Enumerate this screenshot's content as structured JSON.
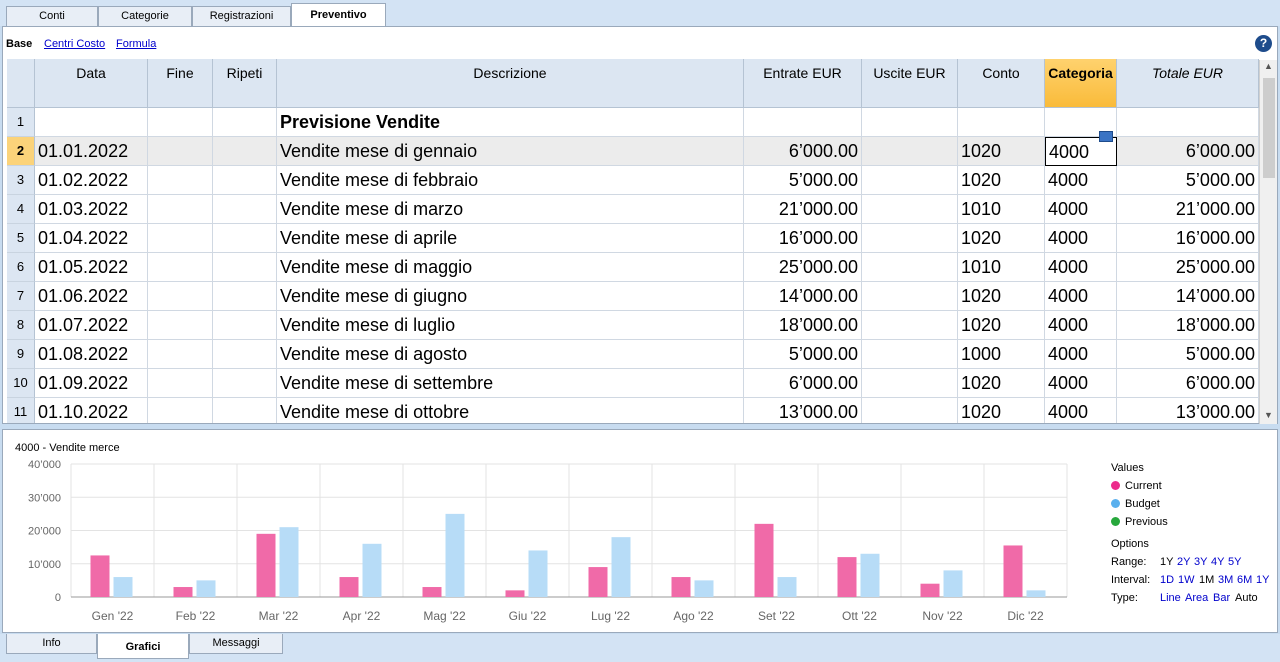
{
  "tabs": [
    "Conti",
    "Categorie",
    "Registrazioni",
    "Preventivo"
  ],
  "active_tab": "Preventivo",
  "views": {
    "base": "Base",
    "centri": "Centri Costo",
    "formula": "Formula"
  },
  "help_icon": "question-circle-icon",
  "columns": {
    "data": "Data",
    "fine": "Fine",
    "ripeti": "Ripeti",
    "descrizione": "Descrizione",
    "entrate": "Entrate EUR",
    "uscite": "Uscite EUR",
    "conto": "Conto",
    "categoria": "Categoria",
    "totale": "Totale EUR"
  },
  "rows": [
    {
      "n": "1",
      "data": "",
      "descrizione": "Previsione Vendite",
      "entrate": "",
      "conto": "",
      "categoria": "",
      "totale": ""
    },
    {
      "n": "2",
      "data": "01.01.2022",
      "descrizione": "Vendite mese di gennaio",
      "entrate": "6’000.00",
      "conto": "1020",
      "categoria": "4000",
      "totale": "6’000.00"
    },
    {
      "n": "3",
      "data": "01.02.2022",
      "descrizione": "Vendite mese di febbraio",
      "entrate": "5’000.00",
      "conto": "1020",
      "categoria": "4000",
      "totale": "5’000.00"
    },
    {
      "n": "4",
      "data": "01.03.2022",
      "descrizione": "Vendite mese di marzo",
      "entrate": "21’000.00",
      "conto": "1010",
      "categoria": "4000",
      "totale": "21’000.00"
    },
    {
      "n": "5",
      "data": "01.04.2022",
      "descrizione": "Vendite mese di aprile",
      "entrate": "16’000.00",
      "conto": "1020",
      "categoria": "4000",
      "totale": "16’000.00"
    },
    {
      "n": "6",
      "data": "01.05.2022",
      "descrizione": "Vendite mese di maggio",
      "entrate": "25’000.00",
      "conto": "1010",
      "categoria": "4000",
      "totale": "25’000.00"
    },
    {
      "n": "7",
      "data": "01.06.2022",
      "descrizione": "Vendite mese di giugno",
      "entrate": "14’000.00",
      "conto": "1020",
      "categoria": "4000",
      "totale": "14’000.00"
    },
    {
      "n": "8",
      "data": "01.07.2022",
      "descrizione": "Vendite mese di luglio",
      "entrate": "18’000.00",
      "conto": "1020",
      "categoria": "4000",
      "totale": "18’000.00"
    },
    {
      "n": "9",
      "data": "01.08.2022",
      "descrizione": "Vendite mese di agosto",
      "entrate": "5’000.00",
      "conto": "1000",
      "categoria": "4000",
      "totale": "5’000.00"
    },
    {
      "n": "10",
      "data": "01.09.2022",
      "descrizione": "Vendite mese di settembre",
      "entrate": "6’000.00",
      "conto": "1020",
      "categoria": "4000",
      "totale": "6’000.00"
    },
    {
      "n": "11",
      "data": "01.10.2022",
      "descrizione": "Vendite mese di ottobre",
      "entrate": "13’000.00",
      "conto": "1020",
      "categoria": "4000",
      "totale": "13’000.00"
    }
  ],
  "selected_row": "2",
  "chart_data": {
    "type": "bar",
    "title": "4000 - Vendite merce",
    "categories": [
      "Gen '22",
      "Feb '22",
      "Mar '22",
      "Apr '22",
      "Mag '22",
      "Giu '22",
      "Lug '22",
      "Ago '22",
      "Set '22",
      "Ott '22",
      "Nov '22",
      "Dic '22"
    ],
    "series": [
      {
        "name": "Current",
        "color": "#f06aa8",
        "values": [
          12500,
          3000,
          19000,
          6000,
          3000,
          2000,
          9000,
          6000,
          22000,
          12000,
          4000,
          15500
        ]
      },
      {
        "name": "Budget",
        "color": "#b7dcf7",
        "values": [
          6000,
          5000,
          21000,
          16000,
          25000,
          14000,
          18000,
          5000,
          6000,
          13000,
          8000,
          2000
        ]
      }
    ],
    "yticks": [
      "0",
      "10’000",
      "20’000",
      "30’000",
      "40’000"
    ],
    "ylim": [
      0,
      40000
    ],
    "grid": true
  },
  "legend": {
    "heading": "Values",
    "items": [
      {
        "label": "Current",
        "color": "#ec2c8c"
      },
      {
        "label": "Budget",
        "color": "#5ab0ee"
      },
      {
        "label": "Previous",
        "color": "#27a83c"
      }
    ],
    "options_heading": "Options",
    "range_label": "Range:",
    "range_current": "1Y",
    "range_links": [
      "2Y",
      "3Y",
      "4Y",
      "5Y"
    ],
    "interval_label": "Interval:",
    "interval_links_before": [
      "1D",
      "1W"
    ],
    "interval_current": "1M",
    "interval_links_after": [
      "3M",
      "6M",
      "1Y"
    ],
    "type_label": "Type:",
    "type_links": [
      "Line",
      "Area",
      "Bar"
    ],
    "type_current": "Auto"
  },
  "bottom_tabs": [
    "Info",
    "Grafici",
    "Messaggi"
  ],
  "bottom_active": "Grafici"
}
